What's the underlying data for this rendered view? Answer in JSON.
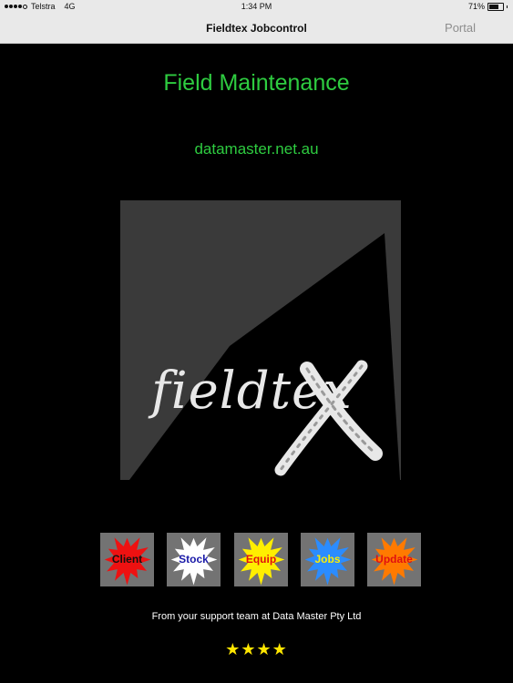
{
  "status": {
    "carrier": "Telstra",
    "network": "4G",
    "time": "1:34 PM",
    "battery_text": "71%",
    "battery_level": 0.71
  },
  "nav": {
    "title": "Fieldtex Jobcontrol",
    "portal_label": "Portal"
  },
  "main": {
    "headline": "Field Maintenance",
    "website": "datamaster.net.au",
    "logo_text": "fieldtex"
  },
  "buttons": [
    {
      "label": "Client",
      "burst_color": "#ee1111",
      "text_color": "#111111"
    },
    {
      "label": "Stock",
      "burst_color": "#ffffff",
      "text_color": "#1a1aa8"
    },
    {
      "label": "Equip",
      "burst_color": "#ffee00",
      "text_color": "#e01010"
    },
    {
      "label": "Jobs",
      "burst_color": "#2b8cff",
      "text_color": "#ffee00"
    },
    {
      "label": "Update",
      "burst_color": "#ff7a00",
      "text_color": "#e01010"
    }
  ],
  "footer": {
    "text": "From your support team at Data Master Pty Ltd",
    "stars": "★★★★"
  },
  "colors": {
    "accent_green": "#2ecc40",
    "star_yellow": "#ffe600",
    "tile_gray": "#737373"
  }
}
